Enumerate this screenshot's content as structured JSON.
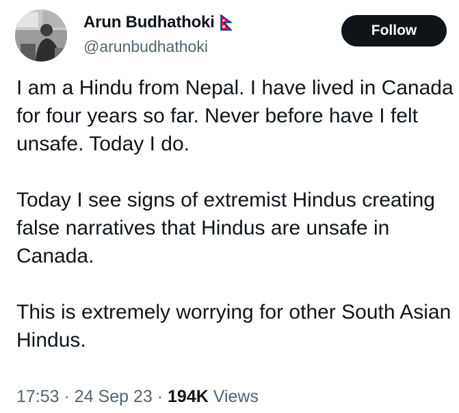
{
  "author": {
    "display_name": "Arun Budhathoki",
    "handle": "@arunbudhathoki",
    "flag_icon": "nepal-flag-icon"
  },
  "actions": {
    "follow_label": "Follow"
  },
  "tweet": {
    "paragraphs": [
      "I am a Hindu from Nepal. I have lived in Canada for four years so far. Never before have I felt unsafe. Today I do.",
      "Today I see signs of extremist Hindus creating false narratives that Hindus are unsafe in Canada.",
      "This is extremely worrying for other South Asian Hindus."
    ]
  },
  "meta": {
    "time": "17:53",
    "sep1": "·",
    "date": "24 Sep 23",
    "sep2": "·",
    "views_count": "194K",
    "views_label": "Views"
  },
  "colors": {
    "text": "#0f1419",
    "secondary": "#536471",
    "follow_bg": "#0f1419",
    "follow_text": "#ffffff",
    "flag_red": "#dc143c",
    "flag_blue": "#003893"
  }
}
